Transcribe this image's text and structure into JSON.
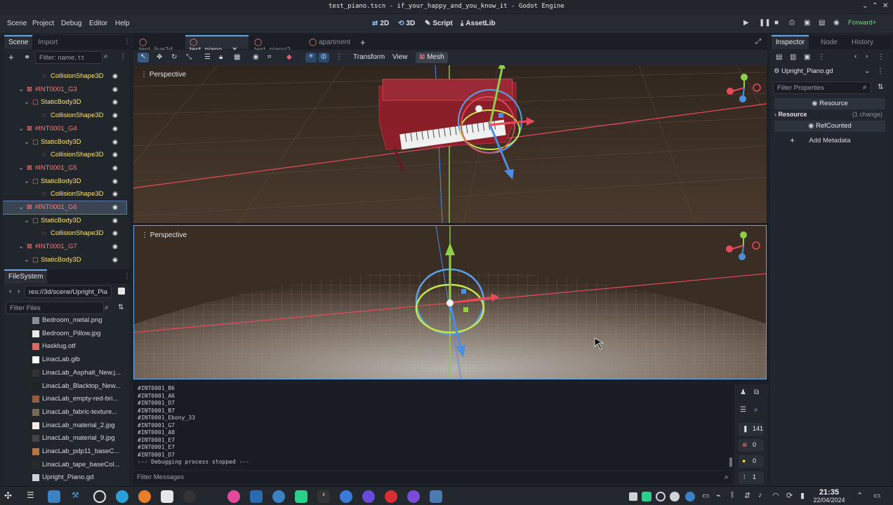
{
  "window": {
    "title": "test_piano.tscn - if_your_happy_and_you_know_it - Godot Engine",
    "controls": [
      "⌄",
      "⌃",
      "✕"
    ]
  },
  "menu": {
    "items": [
      "Scene",
      "Project",
      "Debug",
      "Editor",
      "Help"
    ],
    "modes": [
      "2D",
      "3D",
      "Script",
      "AssetLib"
    ],
    "renderer": "Forward+"
  },
  "scene_dock": {
    "tabs": [
      "Scene",
      "Import"
    ],
    "filter_placeholder": "Filter: name, t:t",
    "nodes": [
      {
        "label": "CollisionShape3D",
        "kind": "collision",
        "indent": 1
      },
      {
        "label": "#INT0001_G3",
        "kind": "mesh",
        "indent": 0
      },
      {
        "label": "StaticBody3D",
        "kind": "body",
        "indent": 1
      },
      {
        "label": "CollisionShape3D",
        "kind": "collision",
        "indent": 2
      },
      {
        "label": "#INT0001_G4",
        "kind": "mesh",
        "indent": 0
      },
      {
        "label": "StaticBody3D",
        "kind": "body",
        "indent": 1
      },
      {
        "label": "CollisionShape3D",
        "kind": "collision",
        "indent": 2
      },
      {
        "label": "#INT0001_G5",
        "kind": "mesh",
        "indent": 0
      },
      {
        "label": "StaticBody3D",
        "kind": "body",
        "indent": 1
      },
      {
        "label": "CollisionShape3D",
        "kind": "collision",
        "indent": 2
      },
      {
        "label": "#INT0001_G6",
        "kind": "mesh",
        "indent": 0,
        "selected": true
      },
      {
        "label": "StaticBody3D",
        "kind": "body",
        "indent": 1
      },
      {
        "label": "CollisionShape3D",
        "kind": "collision",
        "indent": 2
      },
      {
        "label": "#INT0001_G7",
        "kind": "mesh",
        "indent": 0
      },
      {
        "label": "StaticBody3D",
        "kind": "body",
        "indent": 1
      }
    ]
  },
  "filesystem": {
    "tab": "FileSystem",
    "path": "res://3d/scene/Upright_Pia",
    "filter_placeholder": "Filter Files",
    "files": [
      {
        "name": "Bedroom_metal.png",
        "color": "#8a8f96"
      },
      {
        "name": "Bedroom_Pillow.jpg",
        "color": "#e8e8e8"
      },
      {
        "name": "Hasklug.otf",
        "color": "#e06666"
      },
      {
        "name": "LinacLab.glb",
        "color": "#ffffff"
      },
      {
        "name": "LinacLab_Asphalt_New.j...",
        "color": "#333333"
      },
      {
        "name": "LinacLab_Blacktop_New...",
        "color": "#222222"
      },
      {
        "name": "LinacLab_empty-red-bri...",
        "color": "#9a5a40"
      },
      {
        "name": "LinacLab_fabric-texture...",
        "color": "#7a6a55"
      },
      {
        "name": "LinacLab_material_2.jpg",
        "color": "#f4ecdd"
      },
      {
        "name": "LinacLab_material_9.jpg",
        "color": "#444444"
      },
      {
        "name": "LinacLab_pdp11_baseC...",
        "color": "#b8763f"
      },
      {
        "name": "LinacLab_tape_baseCol...",
        "color": "#2a2a2a"
      },
      {
        "name": "Upright_Piano.gd",
        "color": "#c9d1da"
      }
    ]
  },
  "editor_tabs": {
    "tabs": [
      "test_live2d",
      "test_piano",
      "test_piano2",
      "apartment"
    ],
    "active": "test_piano"
  },
  "viewport_toolbar": {
    "menus": [
      "Transform",
      "View",
      "Mesh"
    ]
  },
  "viewports": {
    "top_label": "Perspective",
    "bottom_label": "Perspective"
  },
  "inspector": {
    "tabs": [
      "Inspector",
      "Node",
      "History"
    ],
    "script": "Upright_Piano.gd",
    "filter_placeholder": "Filter Properties",
    "section_resource": "Resource",
    "resource_label": "Resource",
    "resource_changes": "(1 change)",
    "refcounted": "RefCounted",
    "add_metadata": "Add Metadata"
  },
  "output": {
    "lines": [
      "#INT0001_B6",
      "#INT0001_A6",
      "#INT0001_D7",
      "#INT0001_B7",
      "#INT0001_Ebony_33",
      "#INT0001_G7",
      "#INT0001_A8",
      "#INT0001_E7",
      "#INT0001_E7",
      "#INT0001_D7",
      "--- Debugging process stopped ---"
    ],
    "filter_placeholder": "Filter Messages",
    "counts": {
      "messages": "141",
      "errors": "0",
      "warnings": "0",
      "editor": "1"
    }
  },
  "taskbar": {
    "time": "21:35",
    "date": "22/04/2024"
  },
  "colors": {
    "accent": "#6aa7e8",
    "mesh_node": "#ff7a7a",
    "body_node": "#ffe56a"
  }
}
